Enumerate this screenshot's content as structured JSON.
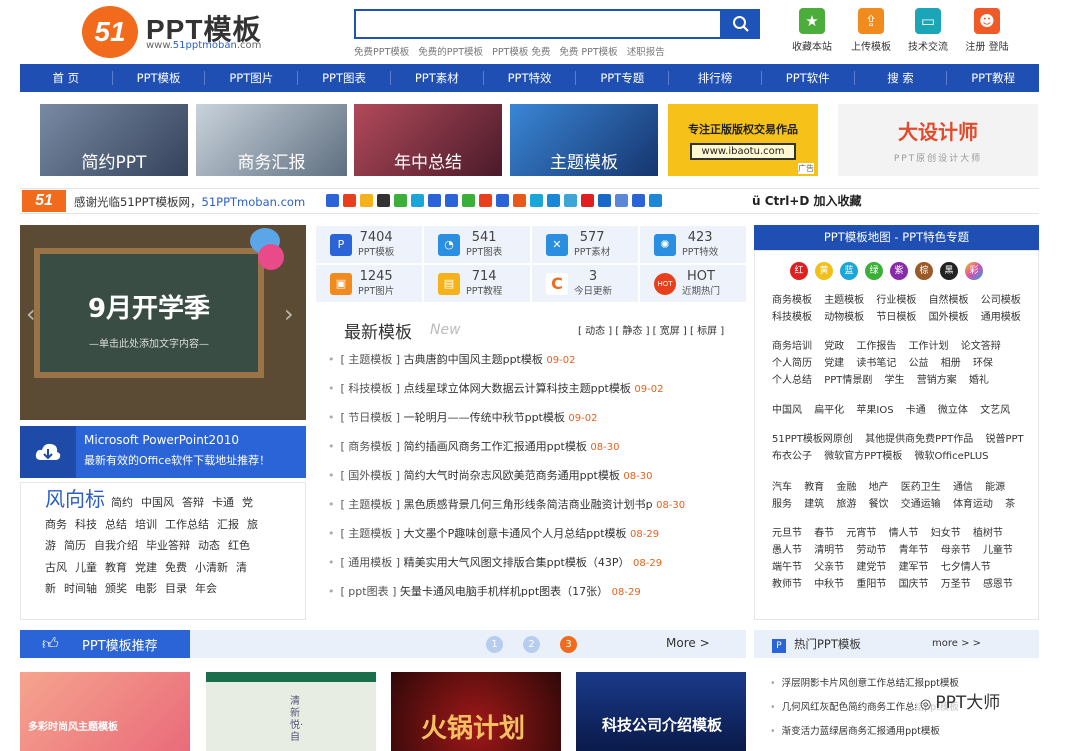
{
  "logo": {
    "badge": "51",
    "name": "PPT模板",
    "url_prefix": "www.",
    "url_brand": "51pptmoban",
    "url_suffix": ".com"
  },
  "search": {
    "placeholder": "",
    "hot_keywords": [
      "免费PPT模板",
      "免费的PPT模板",
      "PPT模板 免费",
      "免费 PPT模板",
      "述职报告"
    ]
  },
  "top_icons": [
    {
      "label": "收藏本站",
      "color": "#4cae3a"
    },
    {
      "label": "上传模板",
      "color": "#f28b1e"
    },
    {
      "label": "技术交流",
      "color": "#1aa6b7"
    },
    {
      "label": "注册 登陆",
      "color": "#f05a28"
    }
  ],
  "nav": [
    "首 页",
    "PPT模板",
    "PPT图片",
    "PPT图表",
    "PPT素材",
    "PPT特效",
    "PPT专题",
    "排行榜",
    "PPT软件",
    "搜 索",
    "PPT教程"
  ],
  "banners": [
    {
      "label": "简约PPT",
      "color": "#4a5a72"
    },
    {
      "label": "商务汇报",
      "color": "#6d7f90"
    },
    {
      "label": "年中总结",
      "color": "#7a3642"
    },
    {
      "label": "主题模板",
      "color": "#1f5c9e"
    },
    {
      "label": "专注正版版权交易作品",
      "sub": "www.ibaotu.com",
      "tag": "广告",
      "color": "#f6c21a"
    },
    {
      "label": "大设计师",
      "sub": "PPT原创设计大师",
      "color": "#f3f3f3"
    }
  ],
  "welcome": {
    "badge": "51",
    "text": "感谢光临51PPT模板网，",
    "brand": "51PPTmoban.com",
    "shortcut": "Ctrl+D 加入收藏"
  },
  "slider": {
    "title": "9月开学季",
    "subtitle": "—单击此处添加文字内容—"
  },
  "ms_promo": {
    "line1": "Microsoft PowerPoint2010",
    "line2": "最新有效的Office软件下载地址推荐！"
  },
  "tags": {
    "big": "风向标",
    "items": [
      "简约",
      "中国风",
      "答辩",
      "卡通",
      "党",
      "商务",
      "科技",
      "总结",
      "培训",
      "工作总结",
      "汇报",
      "旅",
      "游",
      "简历",
      "自我介绍",
      "毕业答辩",
      "动态",
      "红色",
      "古风",
      "儿童",
      "教育",
      "党建",
      "免费",
      "小清新",
      "清",
      "新",
      "时间轴",
      "颁奖",
      "电影",
      "目录",
      "年会"
    ]
  },
  "stats": [
    {
      "n": "7404",
      "label": "PPT模板",
      "color": "#2b64d6",
      "icon": "P"
    },
    {
      "n": "541",
      "label": "PPT图表",
      "color": "#2a8fe0",
      "icon": "◔"
    },
    {
      "n": "577",
      "label": "PPT素材",
      "color": "#2a8fe0",
      "icon": "✕"
    },
    {
      "n": "423",
      "label": "PPT特效",
      "color": "#2a8fe0",
      "icon": "✺"
    },
    {
      "n": "1245",
      "label": "PPT图片",
      "color": "#f28b1e",
      "icon": "▣"
    },
    {
      "n": "714",
      "label": "PPT教程",
      "color": "#f6b21a",
      "icon": "▤"
    },
    {
      "n": "3",
      "label": "今日更新",
      "color": "#f26a1b",
      "icon": "C"
    },
    {
      "n": "HOT",
      "label": "近期热门",
      "color": "#e8401c",
      "icon": "HOT"
    }
  ],
  "newest": {
    "title": "最新模板",
    "sub": "New",
    "links": "[ 动态 ] [ 静态 ] [ 宽屏 ] [ 标屏 ]"
  },
  "news": [
    {
      "cat": "主题模板",
      "title": "古典唐韵中国风主题ppt模板",
      "date": "09-02"
    },
    {
      "cat": "科技模板",
      "title": "点线星球立体网大数据云计算科技主题ppt模板",
      "date": "09-02"
    },
    {
      "cat": "节日模板",
      "title": "一轮明月——传统中秋节ppt模板",
      "date": "09-02"
    },
    {
      "cat": "商务模板",
      "title": "简约插画风商务工作汇报通用ppt模板",
      "date": "08-30"
    },
    {
      "cat": "国外模板",
      "title": "简约大气时尚杂志风欧美范商务通用ppt模板",
      "date": "08-30"
    },
    {
      "cat": "主题模板",
      "title": "黑色质感背景几何三角形线条简洁商业融资计划书p",
      "date": "08-30"
    },
    {
      "cat": "主题模板",
      "title": "大文墨个P趣味创意卡通风个人月总结ppt模板",
      "date": "08-29"
    },
    {
      "cat": "通用模板",
      "title": "精美实用大气风图文排版合集ppt模板（43P）",
      "date": "08-29"
    },
    {
      "cat": "ppt图表",
      "title": "矢量卡通风电脑手机样机ppt图表（17张）",
      "date": "08-29"
    }
  ],
  "map": {
    "title": "PPT模板地图 - PPT特色专题",
    "colors": [
      {
        "label": "红",
        "c": "#e02020"
      },
      {
        "label": "黄",
        "c": "#f2c01a"
      },
      {
        "label": "蓝",
        "c": "#1aa6d7"
      },
      {
        "label": "绿",
        "c": "#3cae3a"
      },
      {
        "label": "紫",
        "c": "#8a2aa8"
      },
      {
        "label": "棕",
        "c": "#9a5a2a"
      },
      {
        "label": "黑",
        "c": "#222222"
      },
      {
        "label": "彩",
        "c": "#d94fb0"
      }
    ],
    "groups": [
      [
        "商务模板",
        "主题模板",
        "行业模板",
        "自然模板",
        "公司模板",
        "科技模板",
        "动物模板",
        "节日模板",
        "国外模板",
        "通用模板"
      ],
      [
        "商务培训",
        "党政",
        "工作报告",
        "工作计划",
        "论文答辩",
        "个人简历",
        "党建",
        "读书笔记",
        "公益",
        "相册",
        "环保",
        "个人总结",
        "PPT情景剧",
        "学生",
        "营销方案",
        "婚礼"
      ],
      [
        "中国风",
        "扁平化",
        "苹果IOS",
        "卡通",
        "微立体",
        "文艺风"
      ],
      [
        "51PPT模板网原创",
        "其他提供商免费PPT作品",
        "锐普PPT",
        "布衣公子",
        "微软官方PPT模板",
        "微软OfficePLUS"
      ],
      [
        "汽车",
        "教育",
        "金融",
        "地产",
        "医药卫生",
        "通信",
        "能源",
        "服务",
        "建筑",
        "旅游",
        "餐饮",
        "交通运输",
        "体育运动",
        "茶"
      ],
      [
        "元旦节",
        "春节",
        "元宵节",
        "情人节",
        "妇女节",
        "植树节",
        "愚人节",
        "清明节",
        "劳动节",
        "青年节",
        "母亲节",
        "儿童节",
        "端午节",
        "父亲节",
        "建党节",
        "建军节",
        "七夕情人节",
        "教师节",
        "中秋节",
        "重阳节",
        "国庆节",
        "万圣节",
        "感恩节"
      ]
    ]
  },
  "recommend": {
    "title": "PPT模板推荐",
    "pages": [
      "1",
      "2",
      "3"
    ],
    "more": "More >"
  },
  "hot": {
    "title": "热门PPT模板",
    "more": "more > >",
    "items": [
      "浮层阴影卡片风创意工作总结汇报ppt模板",
      "几何风红灰配色简约商务工作总结ppt模板",
      "渐变活力蓝绿居商务汇报通用ppt模板"
    ]
  },
  "thumbs": [
    {
      "label": "多彩时尚风主题模板",
      "color": "#f08a7c"
    },
    {
      "label": "清新悦·自",
      "color": "#e8ede4"
    },
    {
      "label": "火锅计划",
      "color": "#5a1010"
    },
    {
      "label": "科技公司介绍模板",
      "color": "#0f2a6a"
    }
  ],
  "watermark": "PPT大师"
}
